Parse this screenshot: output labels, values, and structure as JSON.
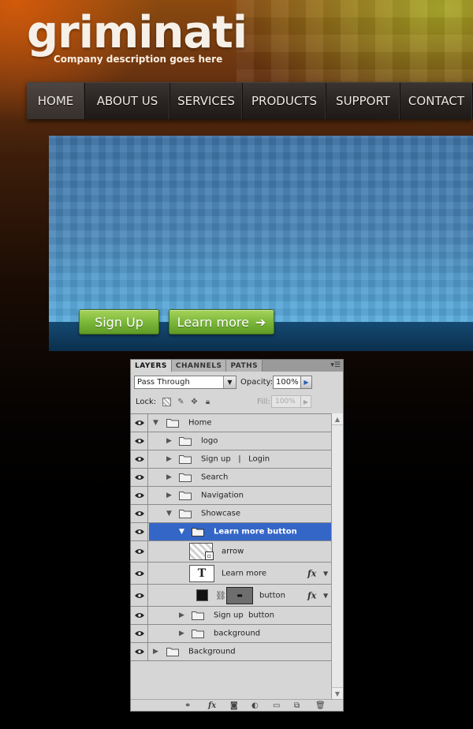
{
  "logo": {
    "name": "griminati",
    "tagline": "Company description goes here"
  },
  "nav": {
    "items": [
      {
        "label": "HOME"
      },
      {
        "label": "ABOUT US"
      },
      {
        "label": "SERVICES"
      },
      {
        "label": "PRODUCTS"
      },
      {
        "label": "SUPPORT"
      },
      {
        "label": "CONTACT"
      }
    ],
    "active_index": 0
  },
  "showcase": {
    "signup_label": "Sign Up",
    "learn_label": "Learn more",
    "learn_arrow": "➔"
  },
  "layers_panel": {
    "tabs": [
      "LAYERS",
      "CHANNELS",
      "PATHS"
    ],
    "active_tab": "LAYERS",
    "menu_glyph": "▾☰",
    "blend_mode": "Pass Through",
    "opacity_label": "Opacity:",
    "opacity_value": "100%",
    "lock_label": "Lock:",
    "fill_label": "Fill:",
    "fill_value": "100%",
    "layers": [
      {
        "name": "Home",
        "type": "group",
        "expanded": true
      },
      {
        "name": "logo",
        "type": "group",
        "expanded": false
      },
      {
        "name": "Sign up   |   Login",
        "type": "group",
        "expanded": false
      },
      {
        "name": "Search",
        "type": "group",
        "expanded": false
      },
      {
        "name": "Navigation",
        "type": "group",
        "expanded": false
      },
      {
        "name": "Showcase",
        "type": "group",
        "expanded": true
      },
      {
        "name": "Learn more button",
        "type": "group",
        "expanded": true,
        "selected": true
      },
      {
        "name": "arrow",
        "type": "smart-object"
      },
      {
        "name": "Learn more",
        "type": "text",
        "fx": "fx"
      },
      {
        "name": "button",
        "type": "shape",
        "fx": "fx"
      },
      {
        "name": "Sign up  button",
        "type": "group",
        "expanded": false
      },
      {
        "name": "background",
        "type": "group",
        "expanded": false
      },
      {
        "name": "Background",
        "type": "group",
        "expanded": false
      }
    ],
    "text_thumb": "T",
    "footer_icons": [
      "link-icon",
      "fx-icon",
      "mask-icon",
      "adjustment-icon",
      "new-group-icon",
      "new-layer-icon",
      "trash-icon"
    ]
  },
  "colors": {
    "nav_bg": "#2a2523",
    "button_green": "#7cb83a",
    "selected_layer": "#3466c7",
    "showcase_blue": "#4a86b8"
  }
}
